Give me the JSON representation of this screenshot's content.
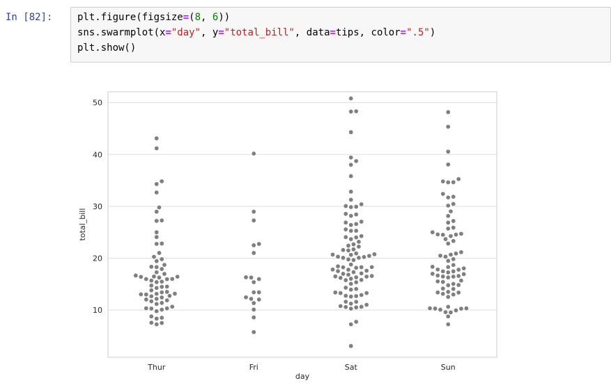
{
  "cell": {
    "prompt": "In [82]:",
    "code_lines": [
      [
        {
          "t": "plt.figure(figsize"
        },
        {
          "t": "=",
          "c": "op"
        },
        {
          "t": "("
        },
        {
          "t": "8",
          "c": "num"
        },
        {
          "t": ", "
        },
        {
          "t": "6",
          "c": "num"
        },
        {
          "t": "))"
        }
      ],
      [
        {
          "t": "sns.swarmplot(x"
        },
        {
          "t": "=",
          "c": "op"
        },
        {
          "t": "\"day\"",
          "c": "str"
        },
        {
          "t": ", y"
        },
        {
          "t": "=",
          "c": "op"
        },
        {
          "t": "\"total_bill\"",
          "c": "str"
        },
        {
          "t": ", data"
        },
        {
          "t": "=",
          "c": "op"
        },
        {
          "t": "tips, color"
        },
        {
          "t": "=",
          "c": "op"
        },
        {
          "t": "\".5\"",
          "c": "str"
        },
        {
          "t": ")"
        }
      ],
      [
        {
          "t": "plt.show()"
        }
      ]
    ]
  },
  "colors": {
    "prompt": "#303f9f",
    "marker": "#7f7f7f",
    "grid": "#dddddd",
    "spine": "#cccccc",
    "cell_bg": "#f7f7f7"
  },
  "chart_data": {
    "type": "scatter",
    "style": "swarm",
    "title": "",
    "xlabel": "day",
    "ylabel": "total_bill",
    "categories": [
      "Thur",
      "Fri",
      "Sat",
      "Sun"
    ],
    "ylim": [
      0.9,
      52.1
    ],
    "yticks": [
      10,
      20,
      30,
      40,
      50
    ],
    "grid": true,
    "values": {
      "Thur": [
        43.11,
        41.19,
        34.83,
        34.3,
        32.68,
        29.8,
        28.97,
        27.28,
        27.2,
        25.0,
        24.08,
        22.82,
        22.76,
        21.01,
        20.27,
        19.81,
        19.44,
        18.71,
        18.35,
        18.28,
        17.92,
        17.29,
        16.97,
        16.66,
        16.47,
        16.43,
        16.4,
        16.27,
        16.0,
        15.98,
        15.95,
        15.69,
        15.48,
        15.38,
        14.73,
        14.52,
        14.48,
        14.26,
        13.81,
        13.51,
        13.42,
        13.16,
        13.13,
        13.03,
        13.0,
        12.74,
        12.66,
        12.43,
        12.16,
        12.03,
        11.87,
        11.69,
        11.38,
        11.17,
        10.65,
        10.34,
        10.33,
        10.29,
        10.07,
        9.78,
        8.77,
        8.52,
        8.35,
        7.56,
        7.51,
        7.25
      ],
      "Fri": [
        40.17,
        28.97,
        27.28,
        22.75,
        22.49,
        21.01,
        16.32,
        16.27,
        15.98,
        15.38,
        13.42,
        13.42,
        12.46,
        12.16,
        12.03,
        11.35,
        10.09,
        8.58,
        5.75
      ],
      "Sat": [
        50.81,
        48.33,
        48.27,
        44.3,
        39.42,
        38.73,
        38.01,
        35.83,
        32.83,
        31.27,
        30.4,
        30.06,
        29.93,
        29.85,
        28.55,
        28.44,
        28.17,
        27.05,
        26.88,
        26.59,
        26.41,
        25.56,
        25.29,
        25.28,
        24.27,
        24.06,
        24.01,
        23.68,
        23.17,
        22.67,
        22.42,
        22.23,
        21.7,
        21.58,
        21.5,
        20.92,
        20.76,
        20.69,
        20.65,
        20.45,
        20.29,
        20.23,
        20.08,
        20.08,
        19.77,
        19.65,
        18.78,
        18.43,
        18.29,
        18.26,
        18.24,
        18.15,
        17.81,
        17.78,
        17.59,
        17.51,
        17.31,
        17.07,
        16.99,
        16.82,
        16.58,
        16.49,
        16.45,
        16.31,
        16.21,
        16.04,
        15.81,
        15.77,
        15.36,
        15.06,
        14.31,
        14.07,
        13.94,
        13.39,
        13.28,
        13.27,
        12.9,
        12.76,
        12.69,
        12.6,
        11.61,
        11.59,
        11.24,
        11.02,
        10.77,
        10.63,
        10.59,
        10.51,
        10.27,
        7.74,
        7.25,
        3.07
      ],
      "Sun": [
        48.17,
        45.35,
        40.55,
        38.07,
        35.26,
        34.81,
        34.65,
        34.63,
        32.4,
        31.85,
        31.71,
        30.46,
        30.14,
        29.03,
        28.15,
        27.18,
        26.86,
        25.89,
        25.71,
        25.0,
        24.71,
        24.59,
        24.55,
        24.52,
        23.68,
        23.33,
        22.82,
        21.16,
        20.9,
        20.69,
        20.49,
        20.29,
        19.82,
        19.49,
        18.69,
        18.35,
        18.29,
        18.04,
        17.82,
        17.78,
        17.46,
        17.47,
        17.26,
        16.99,
        16.93,
        16.66,
        16.58,
        16.47,
        16.29,
        15.69,
        15.53,
        15.42,
        15.04,
        14.83,
        14.78,
        13.39,
        13.37,
        13.13,
        13.0,
        12.54,
        10.34,
        10.33,
        10.29,
        10.27,
        10.07,
        9.94,
        9.6,
        9.55,
        8.77,
        7.25,
        10.63,
        14.07,
        13.51,
        14.15,
        16.45,
        24.27
      ]
    }
  }
}
